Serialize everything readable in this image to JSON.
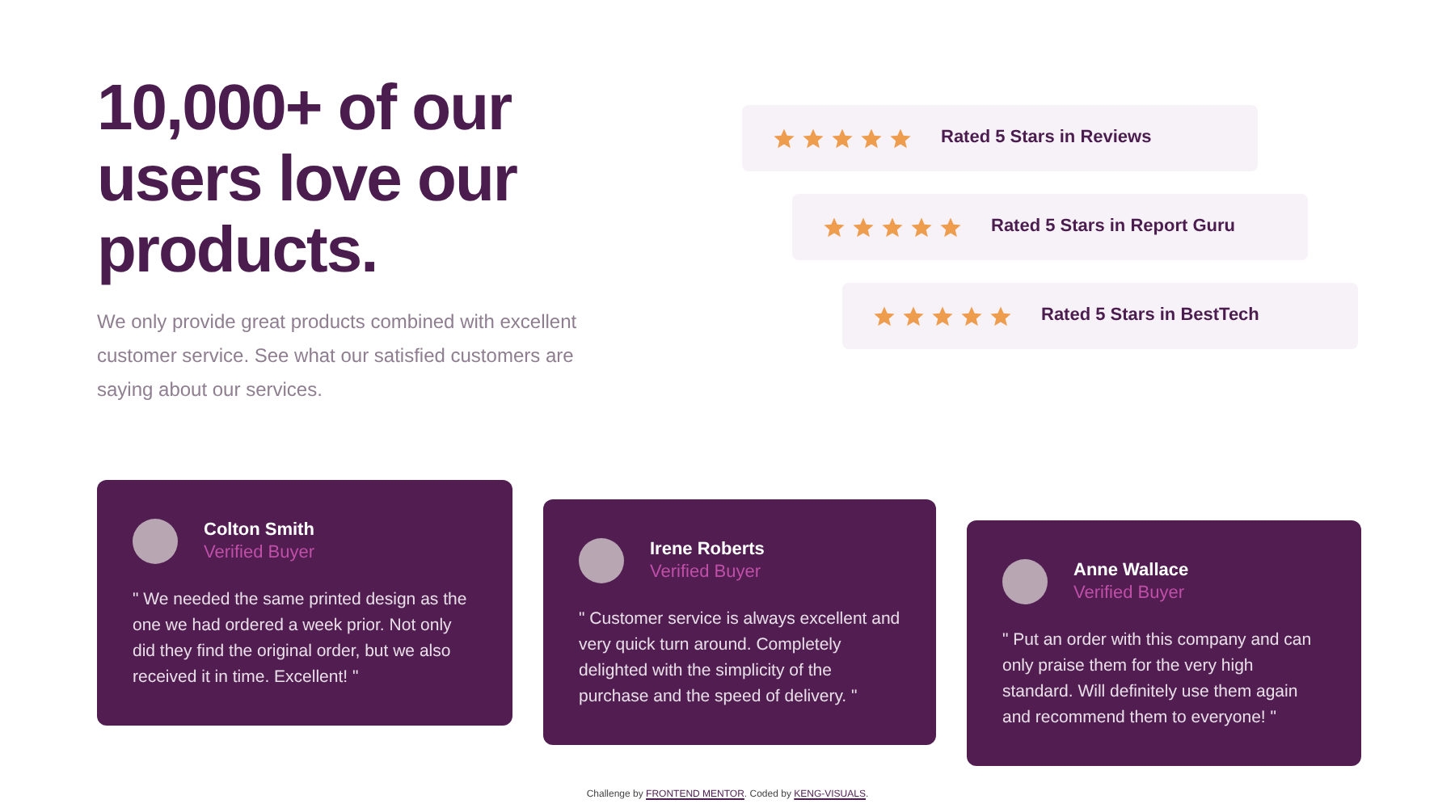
{
  "hero": {
    "heading": "10,000+ of our users love our products.",
    "description": "We only provide great products combined with excellent customer service. See what our satisfied customers are saying about our services."
  },
  "ratings": [
    {
      "stars": 5,
      "label": "Rated 5 Stars in Reviews"
    },
    {
      "stars": 5,
      "label": "Rated 5 Stars in Report Guru"
    },
    {
      "stars": 5,
      "label": "Rated 5 Stars in BestTech"
    }
  ],
  "testimonials": [
    {
      "name": "Colton Smith",
      "role": "Verified Buyer",
      "quote": "\" We needed the same printed design as the one we had ordered a week prior. Not only did they find the original order, but we also received it in time. Excellent! \""
    },
    {
      "name": "Irene Roberts",
      "role": "Verified Buyer",
      "quote": "\" Customer service is always excellent and very quick turn around. Completely delighted with the simplicity of the purchase and the speed of delivery. \""
    },
    {
      "name": "Anne Wallace",
      "role": "Verified Buyer",
      "quote": "\" Put an order with this company and can only praise them for the very high standard. Will definitely use them again and recommend them to everyone! \""
    }
  ],
  "footer": {
    "text_1": "Challenge by",
    "link_1": "FRONTEND MENTOR",
    "text_2": ". Coded by",
    "link_2": "KENG-VISUALS",
    "text_3": "."
  }
}
